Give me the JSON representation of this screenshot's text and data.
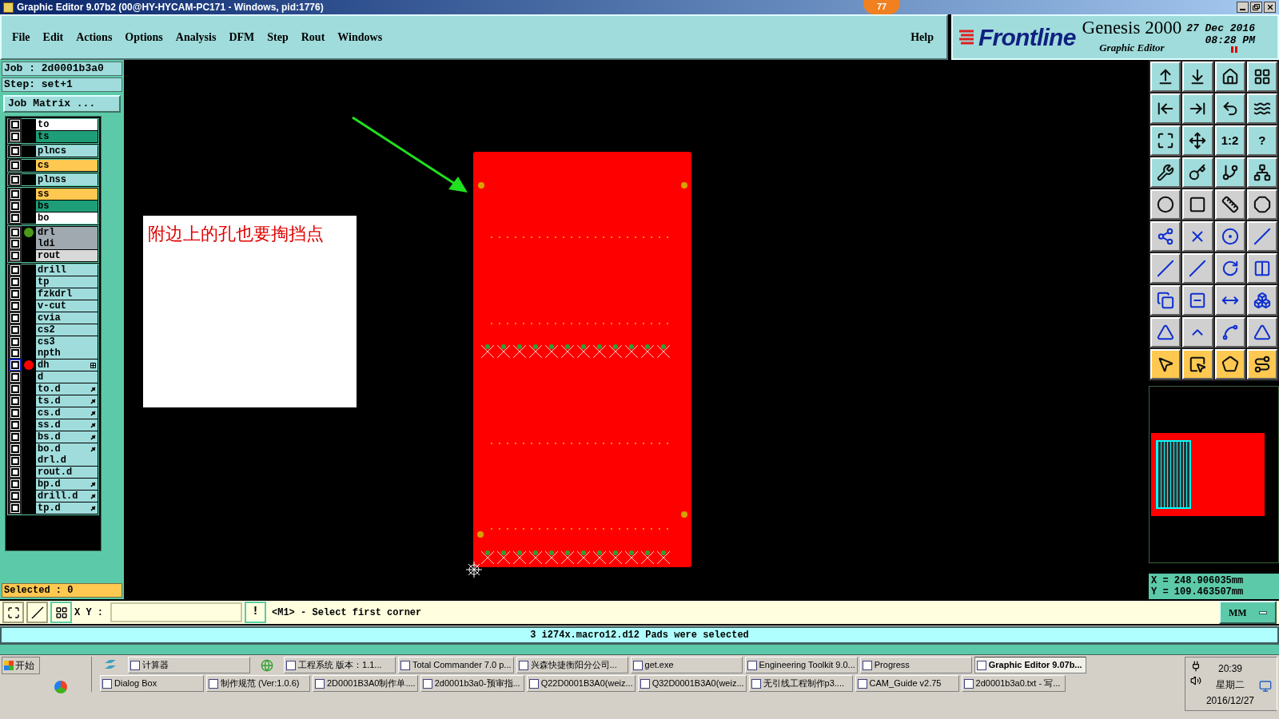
{
  "window": {
    "title": "Graphic Editor 9.07b2 (00@HY-HYCAM-PC171 - Windows, pid:1776)",
    "badge": "77"
  },
  "menu": [
    "File",
    "Edit",
    "Actions",
    "Options",
    "Analysis",
    "DFM",
    "Step",
    "Rout",
    "Windows"
  ],
  "help": "Help",
  "logo": {
    "brand": "Frontline",
    "product": "Genesis 2000",
    "subtitle": "Graphic Editor",
    "date": "27 Dec 2016",
    "time": "08:28 PM"
  },
  "job": {
    "job": "Job : 2d0001b3a0",
    "step": "Step: set+1",
    "matrix_button": "Job Matrix ..."
  },
  "layer_groups": [
    [
      {
        "name": "to",
        "color": "#ffffff",
        "highlighted": false
      },
      {
        "name": "ts",
        "color": "#1e9e78",
        "highlighted": false
      }
    ],
    [
      {
        "name": "plncs",
        "color": "#a0dcdc",
        "highlighted": false
      }
    ],
    [
      {
        "name": "cs",
        "color": "#ffc850",
        "highlighted": false
      }
    ],
    [
      {
        "name": "plnss",
        "color": "#a0dcdc",
        "highlighted": false
      }
    ],
    [
      {
        "name": "ss",
        "color": "#ffc850",
        "highlighted": false
      },
      {
        "name": "bs",
        "color": "#1e9e78",
        "highlighted": false
      },
      {
        "name": "bo",
        "color": "#ffffff",
        "highlighted": false
      }
    ],
    [
      {
        "name": "drl",
        "color": "#a0a8b0",
        "highlighted": false,
        "dot": {
          "color": "#4a9a1a"
        }
      },
      {
        "name": "ldi",
        "color": "#a0a8b0",
        "highlighted": false
      },
      {
        "name": "rout",
        "color": "#d8d8d8",
        "highlighted": false
      }
    ],
    [
      {
        "name": "drill",
        "color": "#a0dcdc",
        "highlighted": false
      },
      {
        "name": "tp",
        "color": "#a0dcdc",
        "highlighted": false
      },
      {
        "name": "fzkdrl",
        "color": "#a0dcdc",
        "highlighted": false
      },
      {
        "name": "v-cut",
        "color": "#a0dcdc",
        "highlighted": false
      },
      {
        "name": "cvia",
        "color": "#a0dcdc",
        "highlighted": false
      },
      {
        "name": "cs2",
        "color": "#a0dcdc",
        "highlighted": false
      },
      {
        "name": "cs3",
        "color": "#a0dcdc",
        "highlighted": false
      },
      {
        "name": "npth",
        "color": "#a0dcdc",
        "highlighted": false
      },
      {
        "name": "dh",
        "color": "#a0dcdc",
        "highlighted": true,
        "dot": {
          "color": "#ff0000"
        },
        "has_attributes": true
      },
      {
        "name": "d",
        "color": "#a0dcdc",
        "highlighted": false
      },
      {
        "name": "to.d",
        "color": "#a0dcdc",
        "highlighted": false,
        "linked": true
      },
      {
        "name": "ts.d",
        "color": "#a0dcdc",
        "highlighted": false,
        "linked": true
      },
      {
        "name": "cs.d",
        "color": "#a0dcdc",
        "highlighted": false,
        "linked": true
      },
      {
        "name": "ss.d",
        "color": "#a0dcdc",
        "highlighted": false,
        "linked": true
      },
      {
        "name": "bs.d",
        "color": "#a0dcdc",
        "highlighted": false,
        "linked": true
      },
      {
        "name": "bo.d",
        "color": "#a0dcdc",
        "highlighted": false,
        "linked": true
      },
      {
        "name": "drl.d",
        "color": "#a0dcdc",
        "highlighted": false
      },
      {
        "name": "rout.d",
        "color": "#a0dcdc",
        "highlighted": false
      },
      {
        "name": "bp.d",
        "color": "#a0dcdc",
        "highlighted": false,
        "linked": true
      },
      {
        "name": "drill.d",
        "color": "#a0dcdc",
        "highlighted": false,
        "linked": true
      },
      {
        "name": "tp.d",
        "color": "#a0dcdc",
        "highlighted": false,
        "linked": true
      }
    ]
  ],
  "selected_count": "Selected : 0",
  "note": "附边上的孔也要掏挡点",
  "toolbar_labels": [
    "1:2",
    "?"
  ],
  "coordinates": {
    "x": "X = 248.906035mm",
    "y": "Y = 109.463507mm"
  },
  "command": {
    "xy_label": "X Y :",
    "bang": "!",
    "prompt": "<M1> - Select first corner",
    "units": "MM"
  },
  "status": "3 i274x.macro12.d12 Pads were selected",
  "taskbar": {
    "start": "开始",
    "row1": [
      {
        "label": "计算器",
        "selected": false
      },
      {
        "label": "工程系统  版本：1.1...",
        "selected": false
      },
      {
        "label": "Total Commander 7.0 p...",
        "selected": false
      },
      {
        "label": "兴森快捷衡阳分公司...",
        "selected": false
      },
      {
        "label": "get.exe",
        "selected": false
      },
      {
        "label": "Engineering Toolkit 9.0...",
        "selected": false
      },
      {
        "label": "Progress",
        "selected": false
      },
      {
        "label": "Graphic Editor 9.07b...",
        "selected": true
      }
    ],
    "row2": [
      {
        "label": "Dialog Box",
        "selected": false
      },
      {
        "label": "制作规范 (Ver:1.0.6)",
        "selected": false
      },
      {
        "label": "2D0001B3A0制作单....",
        "selected": false
      },
      {
        "label": "2d0001b3a0-预审指...",
        "selected": false
      },
      {
        "label": "Q22D0001B3A0(weiz...",
        "selected": false
      },
      {
        "label": "Q32D0001B3A0(weiz...",
        "selected": false
      },
      {
        "label": "无引线工程制作p3....",
        "selected": false
      },
      {
        "label": "CAM_Guide v2.75",
        "selected": false
      },
      {
        "label": "2d0001b3a0.txt - 写...",
        "selected": false
      }
    ],
    "clock": {
      "time": "20:39",
      "weekday": "星期二",
      "date": "2016/12/27"
    }
  }
}
